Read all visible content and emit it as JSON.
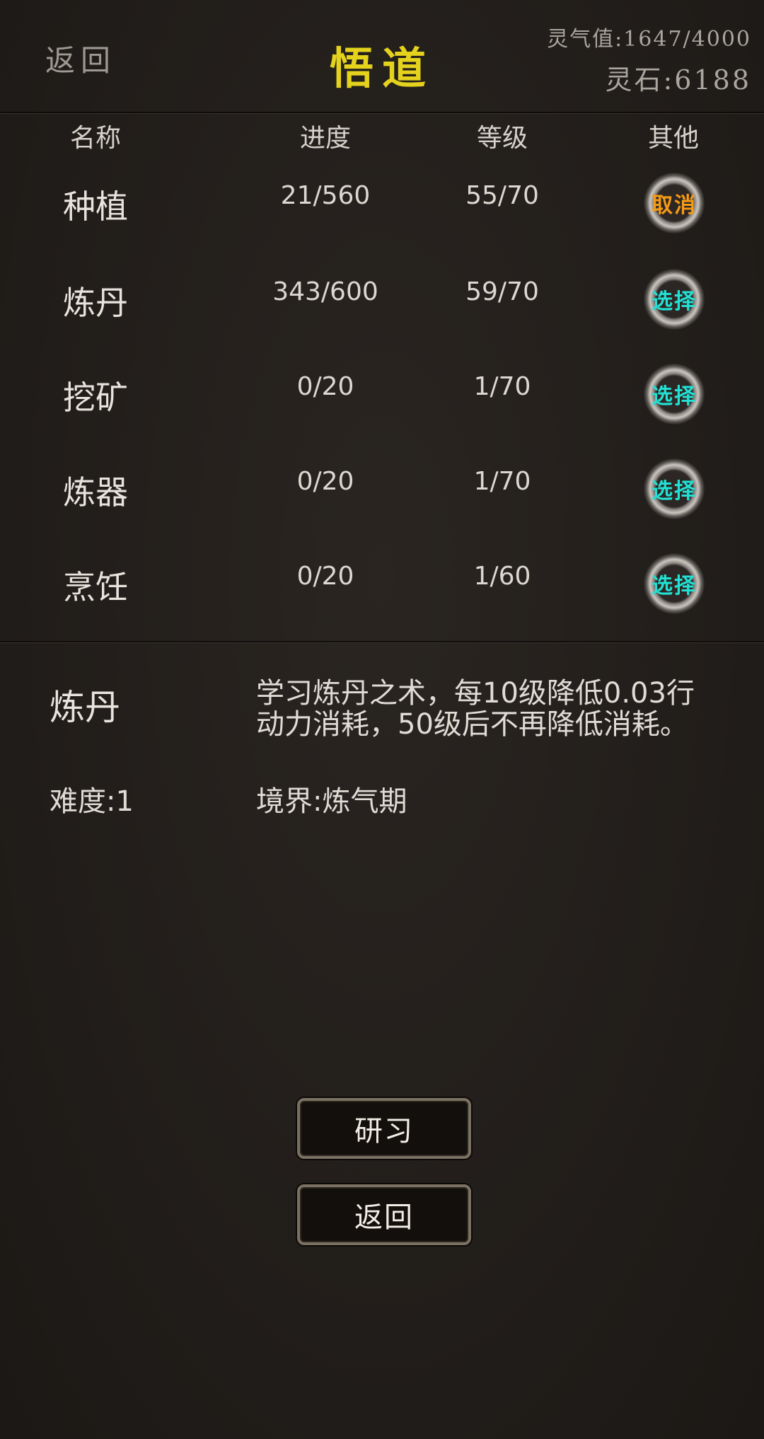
{
  "header": {
    "back_label": "返回",
    "title": "悟道",
    "qi_label": "灵气值:1647/4000",
    "stone_label": "灵石:6188"
  },
  "table": {
    "headers": {
      "name": "名称",
      "progress": "进度",
      "level": "等级",
      "other": "其他"
    },
    "rows": [
      {
        "name": "种植",
        "progress": "21/560",
        "level": "55/70",
        "action": "取消",
        "action_type": "cancel"
      },
      {
        "name": "炼丹",
        "progress": "343/600",
        "level": "59/70",
        "action": "选择",
        "action_type": "select"
      },
      {
        "name": "挖矿",
        "progress": "0/20",
        "level": "1/70",
        "action": "选择",
        "action_type": "select"
      },
      {
        "name": "炼器",
        "progress": "0/20",
        "level": "1/70",
        "action": "选择",
        "action_type": "select"
      },
      {
        "name": "烹饪",
        "progress": "0/20",
        "level": "1/60",
        "action": "选择",
        "action_type": "select"
      }
    ]
  },
  "detail": {
    "name": "炼丹",
    "description": "学习炼丹之术，每10级降低0.03行动力消耗，50级后不再降低消耗。",
    "difficulty": "难度:1",
    "realm": "境界:炼气期"
  },
  "buttons": {
    "study": "研习",
    "back": "返回"
  },
  "colors": {
    "title": "#e4d21d",
    "cancel": "#f59a16",
    "select": "#22e0d4",
    "background": "#221e1b"
  }
}
